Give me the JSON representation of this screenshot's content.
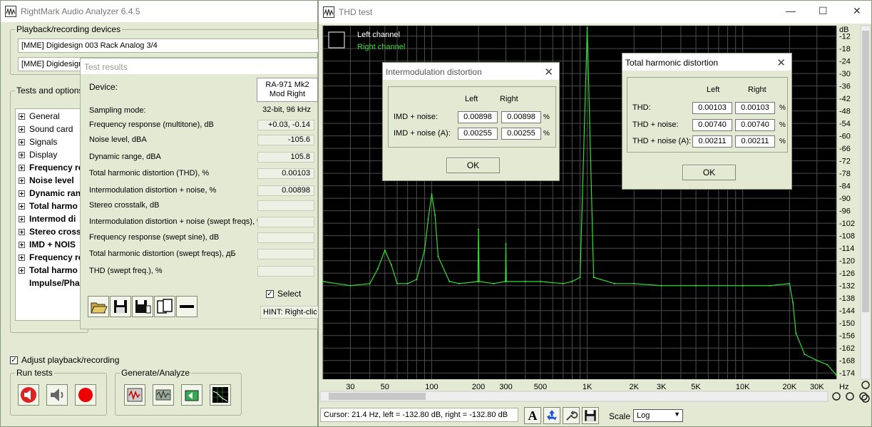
{
  "main_window": {
    "title": "RightMark Audio Analyzer 6.4.5",
    "devices_group_label": "Playback/recording devices",
    "playback_device": "[MME] Digidesign 003 Rack Analog 3/4",
    "recording_device": "[MME] Digidesign",
    "tests_group_label": "Tests and options",
    "tree_items": [
      {
        "label": "General",
        "bold": false
      },
      {
        "label": "Sound card",
        "bold": false
      },
      {
        "label": "Signals",
        "bold": false
      },
      {
        "label": "Display",
        "bold": false
      },
      {
        "label": "Frequency re",
        "bold": true
      },
      {
        "label": "Noise level",
        "bold": true
      },
      {
        "label": "Dynamic ran",
        "bold": true
      },
      {
        "label": "Total harmo",
        "bold": true
      },
      {
        "label": "Intermod di",
        "bold": true
      },
      {
        "label": "Stereo cross",
        "bold": true
      },
      {
        "label": "IMD + NOIS",
        "bold": true
      },
      {
        "label": "Frequency re",
        "bold": true
      },
      {
        "label": "Total harmo",
        "bold": true
      },
      {
        "label": "Impulse/Pha",
        "bold": true
      }
    ],
    "adjust_label": "Adjust playback/recording",
    "adjust_checked": "✓",
    "run_tests_label": "Run tests",
    "generate_label": "Generate/Analyze"
  },
  "test_results": {
    "title": "Test results",
    "device_label": "Device:",
    "device_name_line1": "RA-971 Mk2",
    "device_name_line2": "Mod Right",
    "rows": [
      {
        "label": "Sampling mode:",
        "value": "32-bit, 96 kHz",
        "boxed": false
      },
      {
        "label": "Frequency response (multitone), dB",
        "value": "+0.03, -0.14",
        "boxed": true
      },
      {
        "label": "Noise level, dBA",
        "value": "-105.6",
        "boxed": true
      },
      {
        "label": "Dynamic range, dBA",
        "value": "105.8",
        "boxed": true
      },
      {
        "label": "Total harmonic distortion (THD), %",
        "value": "0.00103",
        "boxed": true
      },
      {
        "label": "Intermodulation distortion + noise, %",
        "value": "0.00898",
        "boxed": true
      },
      {
        "label": "Stereo crosstalk, dB",
        "value": "",
        "boxed": true
      },
      {
        "label": "Intermodulation distortion + noise (swept freqs), %",
        "value": "",
        "boxed": true
      },
      {
        "label": "Frequency response (swept sine), dB",
        "value": "",
        "boxed": true
      },
      {
        "label": "Total harmonic distortion (swept freqs), дБ",
        "value": "",
        "boxed": true
      },
      {
        "label": "THD (swept freq.), %",
        "value": "",
        "boxed": true
      }
    ],
    "select_label": "Select",
    "select_checked": "✓",
    "hint": "HINT: Right-clic"
  },
  "thd_window": {
    "title": "THD test",
    "legend_left": "Left channel",
    "legend_right": "Right channel",
    "db_unit": "dB",
    "hz_unit": "Hz",
    "db_ticks": [
      "-12",
      "-18",
      "-24",
      "-30",
      "-36",
      "-42",
      "-48",
      "-54",
      "-60",
      "-66",
      "-72",
      "-78",
      "-84",
      "-90",
      "-96",
      "-102",
      "-108",
      "-114",
      "-120",
      "-126",
      "-132",
      "-138",
      "-144",
      "-150",
      "-156",
      "-162",
      "-168",
      "-174"
    ],
    "freq_ticks": [
      "30",
      "50",
      "100",
      "200",
      "300",
      "500",
      "1K",
      "2K",
      "3K",
      "5K",
      "10K",
      "20K",
      "30K"
    ],
    "cursor_text": "Cursor:  21.4 Hz,  left = -132.80 dB,  right = -132.80 dB",
    "scale_label": "Scale",
    "scale_value": "Log",
    "colors": {
      "plot_bg": "#000000",
      "grid": "#4d4d4d",
      "right_channel": "#33dd33",
      "left_channel": "#ffffff"
    }
  },
  "chart_data": {
    "type": "line",
    "title": "",
    "xlabel": "Hz",
    "ylabel": "dB",
    "x_scale": "log",
    "xlim": [
      20,
      40000
    ],
    "ylim": [
      -177,
      -7
    ],
    "grid": true,
    "legend": "top-left",
    "series": [
      {
        "name": "Right channel",
        "x": [
          20,
          30,
          40,
          45,
          50,
          55,
          60,
          70,
          80,
          90,
          95,
          100,
          105,
          110,
          130,
          150,
          198,
          200,
          202,
          250,
          298,
          300,
          302,
          400,
          500,
          700,
          800,
          900,
          1000,
          1100,
          1500,
          2000,
          3000,
          5000,
          10000,
          15000,
          20000,
          21000,
          22000,
          25000,
          30000,
          35000,
          40000
        ],
        "y": [
          -130,
          -132,
          -131,
          -124,
          -115,
          -122,
          -131,
          -131,
          -129,
          -115,
          -100,
          -88,
          -98,
          -118,
          -130,
          -131,
          -130,
          -105,
          -130,
          -131,
          -130,
          -112,
          -130,
          -130,
          -130,
          -131,
          -130,
          -128,
          -8,
          -128,
          -131,
          -131,
          -132,
          -132,
          -132,
          -132,
          -131,
          -140,
          -155,
          -165,
          -168,
          -170,
          -175
        ]
      }
    ]
  },
  "imd_dialog": {
    "title": "Intermodulation distortion",
    "col_left": "Left",
    "col_right": "Right",
    "rows": [
      {
        "label": "IMD + noise:",
        "left": "0.00898",
        "right": "0.00898",
        "unit": "%"
      },
      {
        "label": "IMD + noise (A):",
        "left": "0.00255",
        "right": "0.00255",
        "unit": "%"
      }
    ],
    "ok": "OK"
  },
  "thd_dialog": {
    "title": "Total harmonic distortion",
    "col_left": "Left",
    "col_right": "Right",
    "rows": [
      {
        "label": "THD:",
        "left": "0.00103",
        "right": "0.00103",
        "unit": "%"
      },
      {
        "label": "THD + noise:",
        "left": "0.00740",
        "right": "0.00740",
        "unit": "%"
      },
      {
        "label": "THD + noise (A):",
        "left": "0.00211",
        "right": "0.00211",
        "unit": "%"
      }
    ],
    "ok": "OK"
  }
}
